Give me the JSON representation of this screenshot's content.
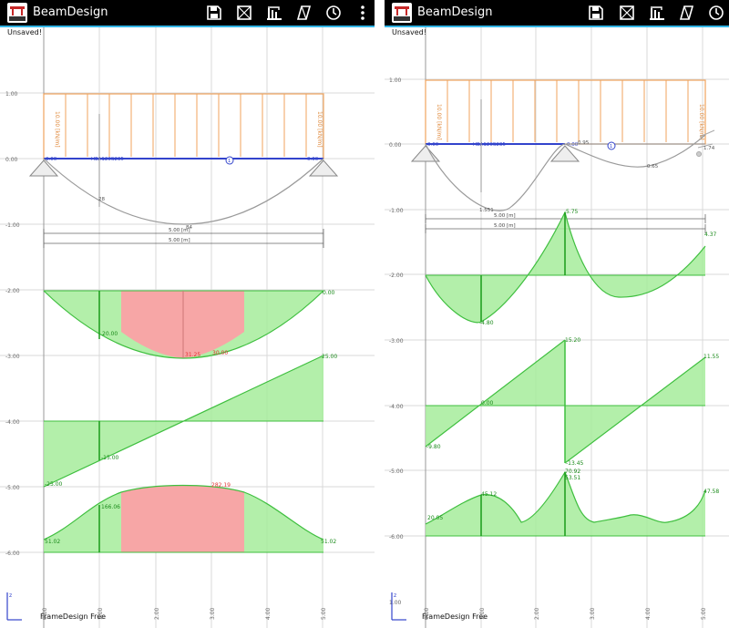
{
  "app": {
    "title": "BeamDesign",
    "unsaved": "Unsaved!",
    "footer": "FrameDesign Free",
    "axis_label": "z",
    "toolbar": [
      {
        "name": "save-icon"
      },
      {
        "name": "frame-icon"
      },
      {
        "name": "section-icon"
      },
      {
        "name": "load-icon"
      },
      {
        "name": "clock-icon"
      },
      {
        "name": "overflow-menu-icon"
      }
    ]
  },
  "colors": {
    "load": "#f0a35e",
    "beam": "#3344cc",
    "positive_fill": "#a6ec9b",
    "overstress_fill": "#f7a6a6",
    "curve": "#3fbf3f",
    "overstress_label": "#e23333",
    "deflection": "#9a9a9a",
    "grid": "#d8d8d8"
  },
  "left": {
    "y_ticks": [
      "1.00",
      "0.00",
      "-1.00",
      "-2.00",
      "-3.00",
      "-4.00",
      "-5.00",
      "-6.00"
    ],
    "x_ticks": [
      "0.00",
      "1.00",
      "2.00",
      "3.00",
      "4.00",
      "5.00"
    ],
    "load_label_left": "10.00 [kN/m]",
    "load_label_right": "10.00 [kN/m]",
    "support_left": "0.00",
    "support_right": "0.00",
    "section_label": "HEA120S235",
    "node_marker": "1",
    "deflection_labels": [
      "28",
      "84"
    ],
    "dim_label_1": "5.00 [m]",
    "dim_label_2": "5.00 [m]",
    "moment_labels": [
      "20.00",
      "31.25",
      "30.00",
      "0.00"
    ],
    "shear_labels": [
      "25.00",
      "-25.00",
      "-15.00"
    ],
    "stress_labels": [
      "51.02",
      "51.02",
      "166.06",
      "282.19"
    ],
    "chart_data": [
      {
        "type": "line",
        "name": "moment",
        "x": [
          0,
          1,
          2,
          2.5,
          3,
          4,
          5
        ],
        "values": [
          0,
          20,
          30,
          31.25,
          30,
          20,
          0
        ]
      },
      {
        "type": "line",
        "name": "shear",
        "x": [
          0,
          1,
          2,
          3,
          4,
          5
        ],
        "values": [
          -25,
          -15,
          -5,
          5,
          15,
          25
        ]
      }
    ]
  },
  "right": {
    "y_ticks": [
      "1.00",
      "0.00",
      "-1.00",
      "-2.00",
      "-3.00",
      "-4.00",
      "-5.00",
      "-6.00"
    ],
    "x_ticks": [
      "0.00",
      "1.00",
      "2.00",
      "3.00",
      "4.00",
      "5.00"
    ],
    "bottom_tick": "1.00",
    "load_label_left": "10.00 [kN/m]",
    "load_label_right": "10.00 [kN/m]",
    "support_left": "0.00",
    "section_label": "HEA120S235",
    "mid_support_label": "0.00",
    "deflection_labels": [
      "0.95",
      "1.551",
      "0.65",
      "1.74"
    ],
    "node_marker": "1",
    "dim_label_1": "5.00 [m]",
    "dim_label_2": "5.00 [m]",
    "moment_labels": [
      "5.75",
      "4.37",
      "-4.80"
    ],
    "shear_labels": [
      "15.20",
      "11.55",
      "-9.80",
      "-13.45",
      "0.00"
    ],
    "stress_labels": [
      "20.05",
      "45.12",
      "70.92",
      "53.51",
      "47.58"
    ],
    "chart_data": [
      {
        "type": "line",
        "name": "moment",
        "x": [
          0,
          1,
          2.5,
          4,
          5
        ],
        "values": [
          0,
          -4.8,
          5.75,
          -3,
          4.37
        ]
      },
      {
        "type": "line",
        "name": "shear",
        "x": [
          0,
          2.5,
          2.5,
          5
        ],
        "values": [
          -9.8,
          15.2,
          -13.45,
          11.55
        ]
      }
    ]
  }
}
